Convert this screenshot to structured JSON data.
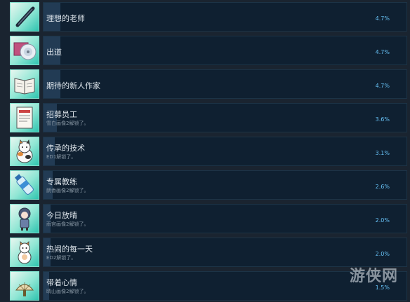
{
  "achievements": [
    {
      "icon": "baton-icon",
      "title": "理想的老师",
      "description": "",
      "percent": "4.7%",
      "percent_value": 4.7
    },
    {
      "icon": "cd-disc-icon",
      "title": "出道",
      "description": "",
      "percent": "4.7%",
      "percent_value": 4.7
    },
    {
      "icon": "open-book-icon",
      "title": "期待的新人作家",
      "description": "",
      "percent": "4.7%",
      "percent_value": 4.7
    },
    {
      "icon": "recruit-poster-icon",
      "title": "招募员工",
      "description": "雪白画像2解锁了。",
      "percent": "3.6%",
      "percent_value": 3.6
    },
    {
      "icon": "calico-cat-icon",
      "title": "传承的技术",
      "description": "ED1解锁了。",
      "percent": "3.1%",
      "percent_value": 3.1
    },
    {
      "icon": "water-bottle-icon",
      "title": "专属教练",
      "description": "朗香画像2解锁了。",
      "percent": "2.6%",
      "percent_value": 2.6
    },
    {
      "icon": "chibi-girl-icon",
      "title": "今日放晴",
      "description": "雨宫画像2解锁了。",
      "percent": "2.0%",
      "percent_value": 2.0
    },
    {
      "icon": "cat-figure-icon",
      "title": "热闹的每一天",
      "description": "ED2解锁了。",
      "percent": "2.0%",
      "percent_value": 2.0
    },
    {
      "icon": "hand-fan-icon",
      "title": "带着心情",
      "description": "晴山画像2解锁了。",
      "percent": "1.5%",
      "percent_value": 1.5
    }
  ],
  "watermark": "游侠网",
  "colors": {
    "background": "#1a2430",
    "panel": "#0f2031",
    "fill": "#223b54",
    "percent_text": "#67c1f5"
  }
}
